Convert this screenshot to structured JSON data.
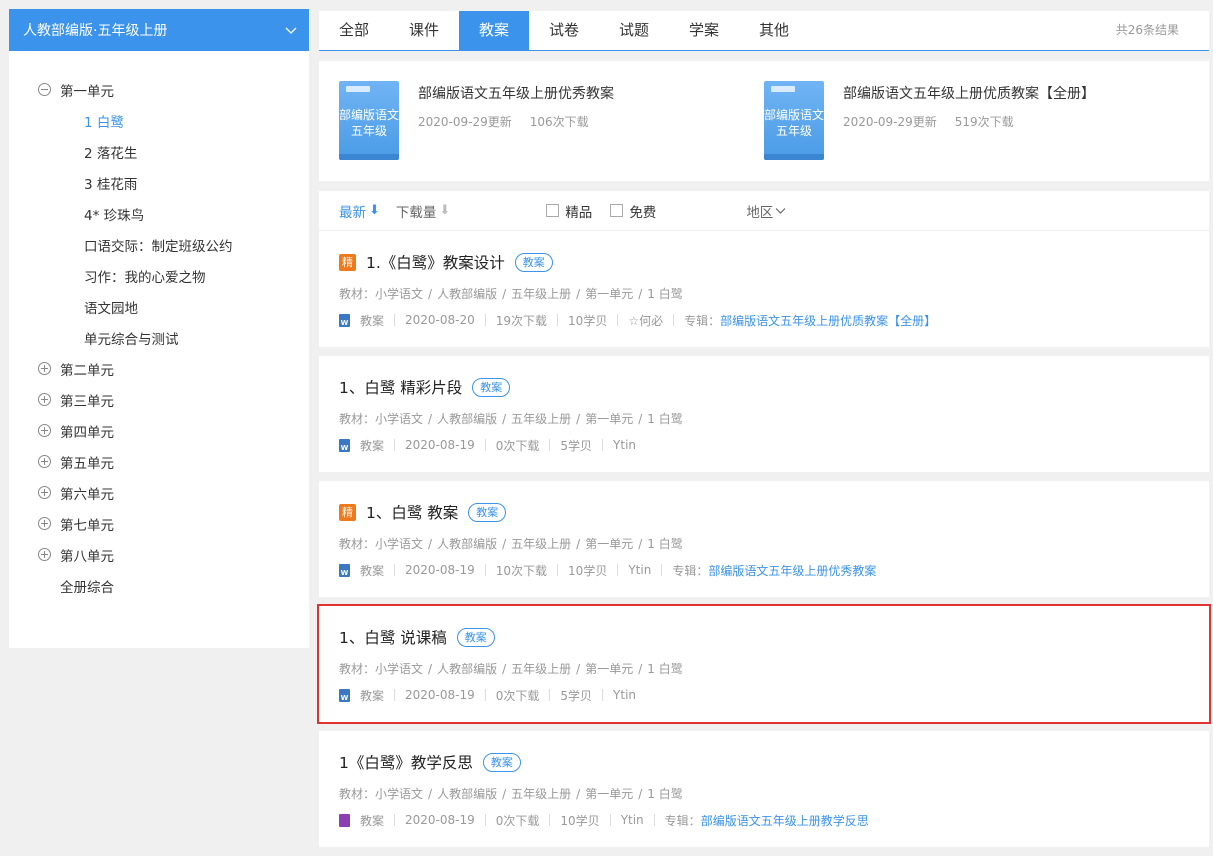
{
  "sidebar": {
    "header": "人教部编版·五年级上册",
    "units": [
      {
        "label": "第一单元",
        "expanded": true,
        "lessons": [
          {
            "label": "1 白鹭",
            "active": true
          },
          {
            "label": "2 落花生"
          },
          {
            "label": "3 桂花雨"
          },
          {
            "label": "4* 珍珠鸟"
          },
          {
            "label": "口语交际：制定班级公约"
          },
          {
            "label": "习作：我的心爱之物"
          },
          {
            "label": "语文园地"
          },
          {
            "label": "单元综合与测试"
          }
        ]
      },
      {
        "label": "第二单元"
      },
      {
        "label": "第三单元"
      },
      {
        "label": "第四单元"
      },
      {
        "label": "第五单元"
      },
      {
        "label": "第六单元"
      },
      {
        "label": "第七单元"
      },
      {
        "label": "第八单元"
      },
      {
        "label": "全册综合"
      }
    ]
  },
  "tabs": [
    "全部",
    "课件",
    "教案",
    "试卷",
    "试题",
    "学案",
    "其他"
  ],
  "active_tab": "教案",
  "result_count": "共26条结果",
  "featured": [
    {
      "cover": "部编版语文五年级",
      "title": "部编版语文五年级上册优秀教案",
      "updated": "2020-09-29更新",
      "downloads": "106次下载"
    },
    {
      "cover": "部编版语文五年级",
      "title": "部编版语文五年级上册优质教案【全册】",
      "updated": "2020-09-29更新",
      "downloads": "519次下载"
    }
  ],
  "filter": {
    "sort_latest": "最新",
    "sort_latest_arrow": "⬇",
    "sort_downloads": "下载量",
    "sort_downloads_arrow": "⬇",
    "check_premium": "精品",
    "check_free": "免费",
    "region": "地区"
  },
  "results": {
    "jing_label": "精",
    "items": [
      {
        "premium": true,
        "title": "1.《白鹭》教案设计",
        "tag": "教案",
        "crumbs": [
          "教材：",
          "小学语文",
          "人教部编版",
          "五年级上册",
          "第一单元",
          "1 白鹭"
        ],
        "file_type": "word-icon",
        "meta": [
          "教案",
          "2020-08-20",
          "19次下载",
          "10学贝",
          "☆何必"
        ],
        "album_label": "专辑：",
        "album": "部编版语文五年级上册优质教案【全册】"
      },
      {
        "premium": false,
        "title": "1、白鹭 精彩片段",
        "tag": "教案",
        "crumbs": [
          "教材：",
          "小学语文",
          "人教部编版",
          "五年级上册",
          "第一单元",
          "1 白鹭"
        ],
        "file_type": "word-icon",
        "meta": [
          "教案",
          "2020-08-19",
          "0次下载",
          "5学贝",
          "Ytin"
        ]
      },
      {
        "premium": true,
        "title": "1、白鹭 教案",
        "tag": "教案",
        "crumbs": [
          "教材：",
          "小学语文",
          "人教部编版",
          "五年级上册",
          "第一单元",
          "1 白鹭"
        ],
        "file_type": "word-icon",
        "meta": [
          "教案",
          "2020-08-19",
          "10次下载",
          "10学贝",
          "Ytin"
        ],
        "album_label": "专辑：",
        "album": "部编版语文五年级上册优秀教案"
      },
      {
        "premium": false,
        "highlight": true,
        "title": "1、白鹭 说课稿",
        "tag": "教案",
        "crumbs": [
          "教材：",
          "小学语文",
          "人教部编版",
          "五年级上册",
          "第一单元",
          "1 白鹭"
        ],
        "file_type": "word-icon",
        "meta": [
          "教案",
          "2020-08-19",
          "0次下载",
          "5学贝",
          "Ytin"
        ]
      },
      {
        "premium": false,
        "title": "1《白鹭》教学反思",
        "tag": "教案",
        "crumbs": [
          "教材：",
          "小学语文",
          "人教部编版",
          "五年级上册",
          "第一单元",
          "1 白鹭"
        ],
        "file_type": "onenote-icon",
        "meta": [
          "教案",
          "2020-08-19",
          "0次下载",
          "10学贝",
          "Ytin"
        ],
        "album_label": "专辑：",
        "album": "部编版语文五年级上册教学反思"
      }
    ]
  },
  "colors": {
    "accent": "#3b93ec",
    "premium": "#f07a1b",
    "highlight_border": "#e0322e"
  }
}
